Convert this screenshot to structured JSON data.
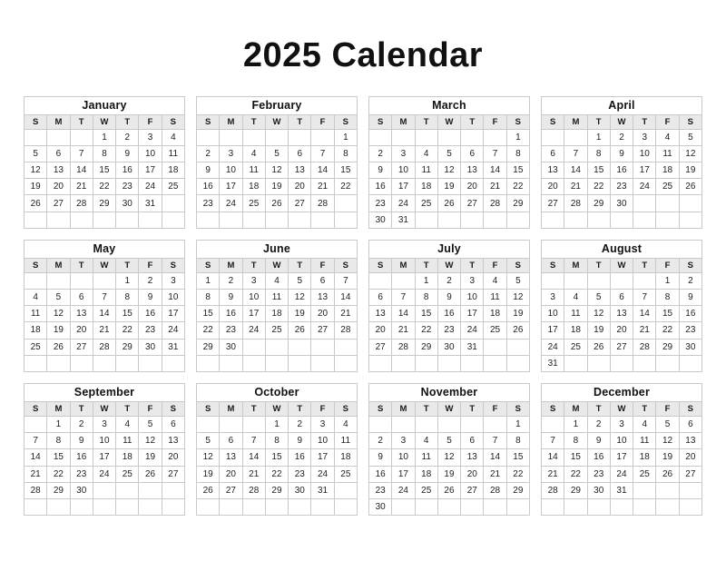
{
  "page": {
    "title": "2025 Calendar",
    "year": "2025",
    "background_color": "#ffffff",
    "text_color": "#111111",
    "header_row_color": "#e9e9e9",
    "border_color": "#c9c9c9"
  },
  "weekday_headers": [
    "S",
    "M",
    "T",
    "W",
    "T",
    "F",
    "S"
  ],
  "months": [
    {
      "name": "January",
      "weeks": [
        [
          "",
          "",
          "",
          "1",
          "2",
          "3",
          "4"
        ],
        [
          "5",
          "6",
          "7",
          "8",
          "9",
          "10",
          "11"
        ],
        [
          "12",
          "13",
          "14",
          "15",
          "16",
          "17",
          "18"
        ],
        [
          "19",
          "20",
          "21",
          "22",
          "23",
          "24",
          "25"
        ],
        [
          "26",
          "27",
          "28",
          "29",
          "30",
          "31",
          ""
        ],
        [
          "",
          "",
          "",
          "",
          "",
          "",
          ""
        ]
      ]
    },
    {
      "name": "February",
      "weeks": [
        [
          "",
          "",
          "",
          "",
          "",
          "",
          "1"
        ],
        [
          "2",
          "3",
          "4",
          "5",
          "6",
          "7",
          "8"
        ],
        [
          "9",
          "10",
          "11",
          "12",
          "13",
          "14",
          "15"
        ],
        [
          "16",
          "17",
          "18",
          "19",
          "20",
          "21",
          "22"
        ],
        [
          "23",
          "24",
          "25",
          "26",
          "27",
          "28",
          ""
        ],
        [
          "",
          "",
          "",
          "",
          "",
          "",
          ""
        ]
      ]
    },
    {
      "name": "March",
      "weeks": [
        [
          "",
          "",
          "",
          "",
          "",
          "",
          "1"
        ],
        [
          "2",
          "3",
          "4",
          "5",
          "6",
          "7",
          "8"
        ],
        [
          "9",
          "10",
          "11",
          "12",
          "13",
          "14",
          "15"
        ],
        [
          "16",
          "17",
          "18",
          "19",
          "20",
          "21",
          "22"
        ],
        [
          "23",
          "24",
          "25",
          "26",
          "27",
          "28",
          "29"
        ],
        [
          "30",
          "31",
          "",
          "",
          "",
          "",
          ""
        ]
      ]
    },
    {
      "name": "April",
      "weeks": [
        [
          "",
          "",
          "1",
          "2",
          "3",
          "4",
          "5"
        ],
        [
          "6",
          "7",
          "8",
          "9",
          "10",
          "11",
          "12"
        ],
        [
          "13",
          "14",
          "15",
          "16",
          "17",
          "18",
          "19"
        ],
        [
          "20",
          "21",
          "22",
          "23",
          "24",
          "25",
          "26"
        ],
        [
          "27",
          "28",
          "29",
          "30",
          "",
          "",
          ""
        ],
        [
          "",
          "",
          "",
          "",
          "",
          "",
          ""
        ]
      ]
    },
    {
      "name": "May",
      "weeks": [
        [
          "",
          "",
          "",
          "",
          "1",
          "2",
          "3"
        ],
        [
          "4",
          "5",
          "6",
          "7",
          "8",
          "9",
          "10"
        ],
        [
          "11",
          "12",
          "13",
          "14",
          "15",
          "16",
          "17"
        ],
        [
          "18",
          "19",
          "20",
          "21",
          "22",
          "23",
          "24"
        ],
        [
          "25",
          "26",
          "27",
          "28",
          "29",
          "30",
          "31"
        ],
        [
          "",
          "",
          "",
          "",
          "",
          "",
          ""
        ]
      ]
    },
    {
      "name": "June",
      "weeks": [
        [
          "1",
          "2",
          "3",
          "4",
          "5",
          "6",
          "7"
        ],
        [
          "8",
          "9",
          "10",
          "11",
          "12",
          "13",
          "14"
        ],
        [
          "15",
          "16",
          "17",
          "18",
          "19",
          "20",
          "21"
        ],
        [
          "22",
          "23",
          "24",
          "25",
          "26",
          "27",
          "28"
        ],
        [
          "29",
          "30",
          "",
          "",
          "",
          "",
          ""
        ],
        [
          "",
          "",
          "",
          "",
          "",
          "",
          ""
        ]
      ]
    },
    {
      "name": "July",
      "weeks": [
        [
          "",
          "",
          "1",
          "2",
          "3",
          "4",
          "5"
        ],
        [
          "6",
          "7",
          "8",
          "9",
          "10",
          "11",
          "12"
        ],
        [
          "13",
          "14",
          "15",
          "16",
          "17",
          "18",
          "19"
        ],
        [
          "20",
          "21",
          "22",
          "23",
          "24",
          "25",
          "26"
        ],
        [
          "27",
          "28",
          "29",
          "30",
          "31",
          "",
          ""
        ],
        [
          "",
          "",
          "",
          "",
          "",
          "",
          ""
        ]
      ]
    },
    {
      "name": "August",
      "weeks": [
        [
          "",
          "",
          "",
          "",
          "",
          "1",
          "2"
        ],
        [
          "3",
          "4",
          "5",
          "6",
          "7",
          "8",
          "9"
        ],
        [
          "10",
          "11",
          "12",
          "13",
          "14",
          "15",
          "16"
        ],
        [
          "17",
          "18",
          "19",
          "20",
          "21",
          "22",
          "23"
        ],
        [
          "24",
          "25",
          "26",
          "27",
          "28",
          "29",
          "30"
        ],
        [
          "31",
          "",
          "",
          "",
          "",
          "",
          ""
        ]
      ]
    },
    {
      "name": "September",
      "weeks": [
        [
          "",
          "1",
          "2",
          "3",
          "4",
          "5",
          "6"
        ],
        [
          "7",
          "8",
          "9",
          "10",
          "11",
          "12",
          "13"
        ],
        [
          "14",
          "15",
          "16",
          "17",
          "18",
          "19",
          "20"
        ],
        [
          "21",
          "22",
          "23",
          "24",
          "25",
          "26",
          "27"
        ],
        [
          "28",
          "29",
          "30",
          "",
          "",
          "",
          ""
        ],
        [
          "",
          "",
          "",
          "",
          "",
          "",
          ""
        ]
      ]
    },
    {
      "name": "October",
      "weeks": [
        [
          "",
          "",
          "",
          "1",
          "2",
          "3",
          "4"
        ],
        [
          "5",
          "6",
          "7",
          "8",
          "9",
          "10",
          "11"
        ],
        [
          "12",
          "13",
          "14",
          "15",
          "16",
          "17",
          "18"
        ],
        [
          "19",
          "20",
          "21",
          "22",
          "23",
          "24",
          "25"
        ],
        [
          "26",
          "27",
          "28",
          "29",
          "30",
          "31",
          ""
        ],
        [
          "",
          "",
          "",
          "",
          "",
          "",
          ""
        ]
      ]
    },
    {
      "name": "November",
      "weeks": [
        [
          "",
          "",
          "",
          "",
          "",
          "",
          "1"
        ],
        [
          "2",
          "3",
          "4",
          "5",
          "6",
          "7",
          "8"
        ],
        [
          "9",
          "10",
          "11",
          "12",
          "13",
          "14",
          "15"
        ],
        [
          "16",
          "17",
          "18",
          "19",
          "20",
          "21",
          "22"
        ],
        [
          "23",
          "24",
          "25",
          "26",
          "27",
          "28",
          "29"
        ],
        [
          "30",
          "",
          "",
          "",
          "",
          "",
          ""
        ]
      ]
    },
    {
      "name": "December",
      "weeks": [
        [
          "",
          "1",
          "2",
          "3",
          "4",
          "5",
          "6"
        ],
        [
          "7",
          "8",
          "9",
          "10",
          "11",
          "12",
          "13"
        ],
        [
          "14",
          "15",
          "16",
          "17",
          "18",
          "19",
          "20"
        ],
        [
          "21",
          "22",
          "23",
          "24",
          "25",
          "26",
          "27"
        ],
        [
          "28",
          "29",
          "30",
          "31",
          "",
          "",
          ""
        ],
        [
          "",
          "",
          "",
          "",
          "",
          "",
          ""
        ]
      ]
    }
  ]
}
